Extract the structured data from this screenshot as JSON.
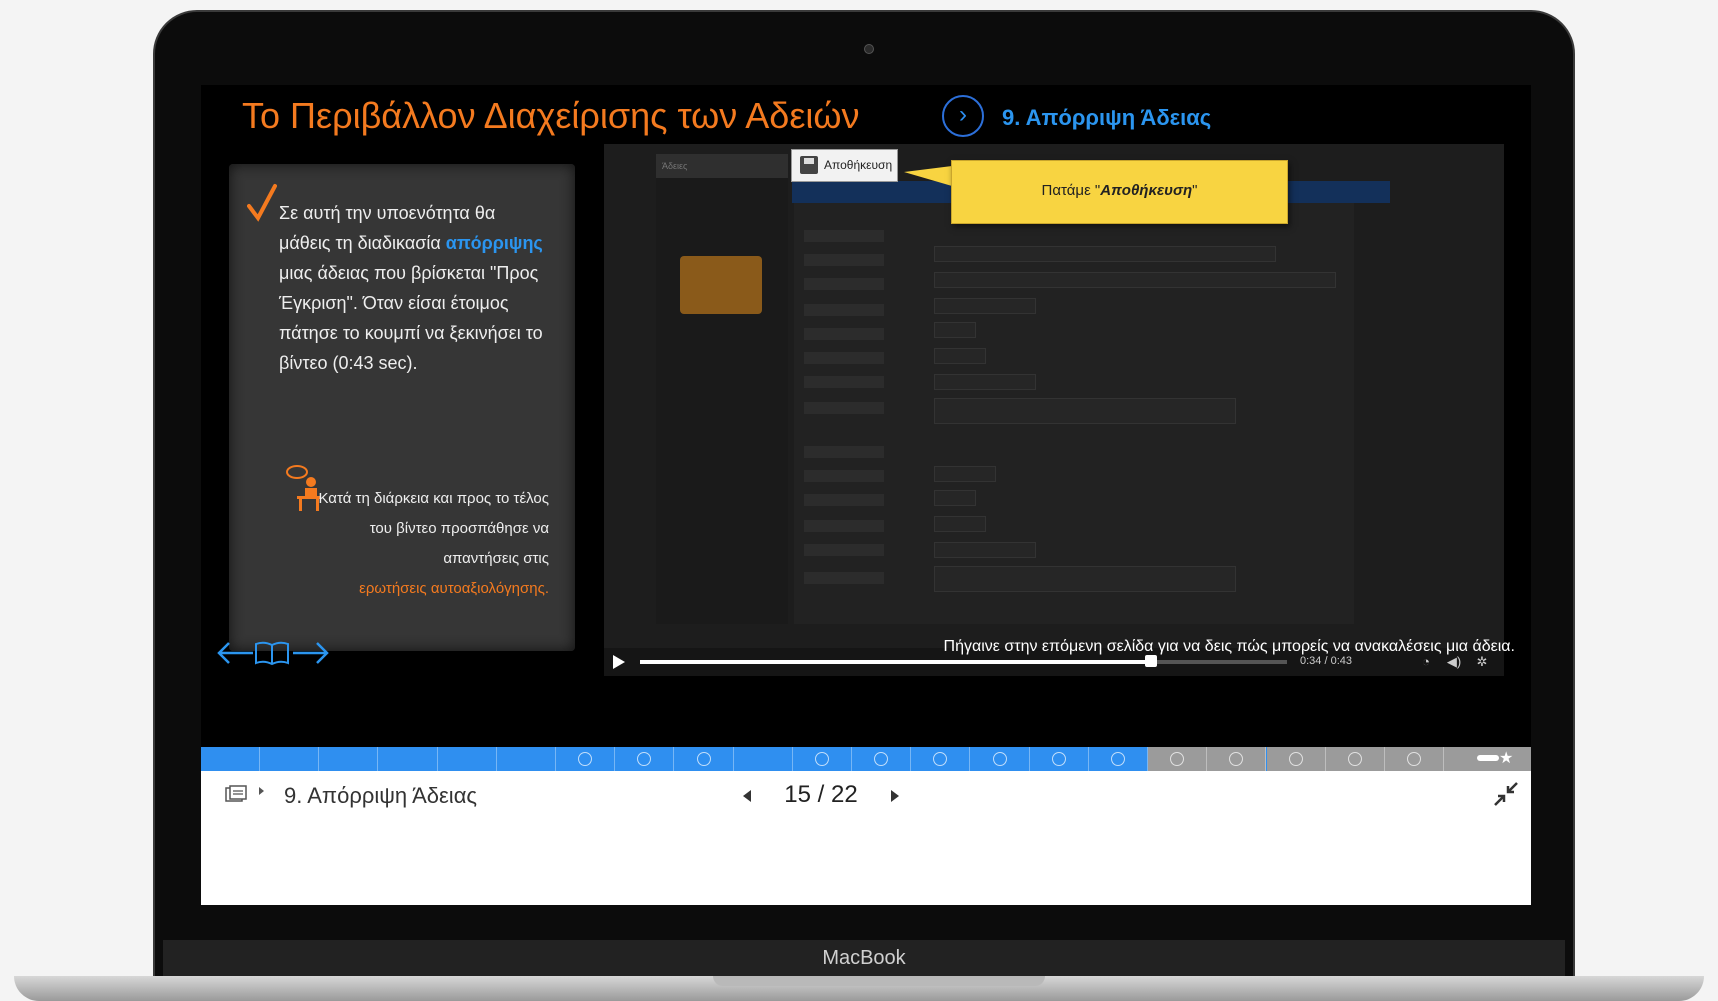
{
  "lesson": {
    "title": "Το Περιβάλλον Διαχείρισης των Αδειών",
    "arrow_glyph": "›",
    "section": "9. Απόρριψη Άδειας"
  },
  "intro": {
    "part1": "Σε αυτή την υποενότητα θα μάθεις τη διαδικασία ",
    "highlight": "απόρριψης",
    "part2": " μιας άδειας που βρίσκεται  \"Προς Έγκριση\". Όταν είσαι έτοιμος πάτησε το κουμπί να ξεκινήσει το βίντεο (0:43 sec)."
  },
  "self_assessment": {
    "text": "Κατά τη διάρκεια και προς το τέλος του βίντεο προσπάθησε να απαντήσεις στις",
    "highlight": "ερωτήσεις αυτοαξιολόγησης."
  },
  "video": {
    "save_button_label": "Αποθήκευση",
    "callout_prefix": "Πατάμε \"",
    "callout_emphasis": "Αποθήκευση",
    "callout_suffix": "\"",
    "time": "0:34 / 0:43",
    "progress_fraction": 0.79,
    "sidebar_head": "Άδειες"
  },
  "navigation": {
    "next_hint": "Πήγαινε στην επόμενη σελίδα για να δεις πώς μπορείς να ανακαλέσεις μια άδεια."
  },
  "footer": {
    "breadcrumb": "9. Απόρριψη Άδειας",
    "current_page": 15,
    "total_pages": 22,
    "pager_text": "15 / 22"
  },
  "device": {
    "brand": "MacBook"
  },
  "colors": {
    "title_orange": "#f47a1f",
    "accent_blue": "#2b95ef",
    "callout_yellow": "#f8d441"
  }
}
